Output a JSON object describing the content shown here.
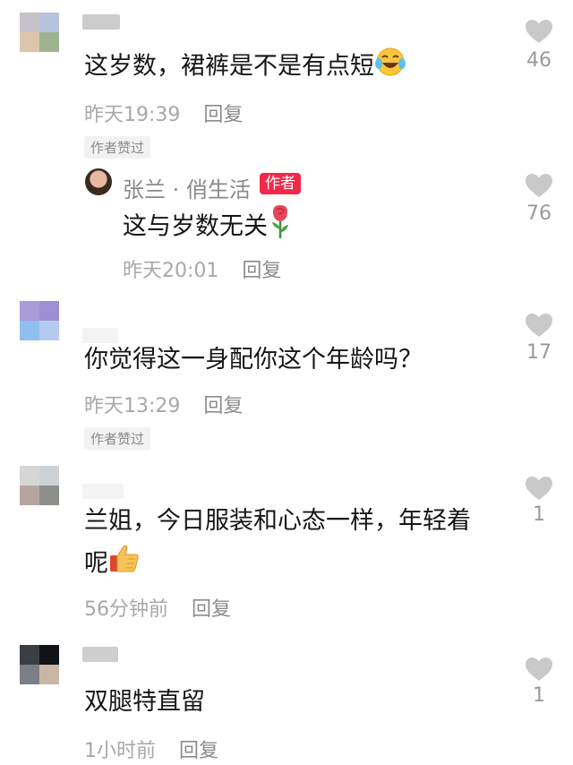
{
  "heart_color": "#c9c9c9",
  "liked_by_author_label": "作者赞过",
  "reply_label": "回复",
  "comments": [
    {
      "text": "这岁数，裙裤是不是有点短",
      "emoji": "laughing-crying-emoji",
      "time": "昨天19:39",
      "likes": "46",
      "liked_by_author": true,
      "reply": {
        "author": "张兰 · 俏生活",
        "badge": "作者",
        "text": "这与岁数无关",
        "emoji": "rose-emoji",
        "time": "昨天20:01",
        "likes": "76"
      }
    },
    {
      "text": "你觉得这一身配你这个年龄吗？",
      "time": "昨天13:29",
      "likes": "17",
      "liked_by_author": true
    },
    {
      "text_line1": "兰姐，今日服装和心态一样，年轻着",
      "text_line2": "呢",
      "emoji": "thumbs-up-emoji",
      "time": "56分钟前",
      "likes": "1"
    },
    {
      "text": "双腿特直留",
      "time": "1小时前",
      "likes": "1"
    }
  ]
}
